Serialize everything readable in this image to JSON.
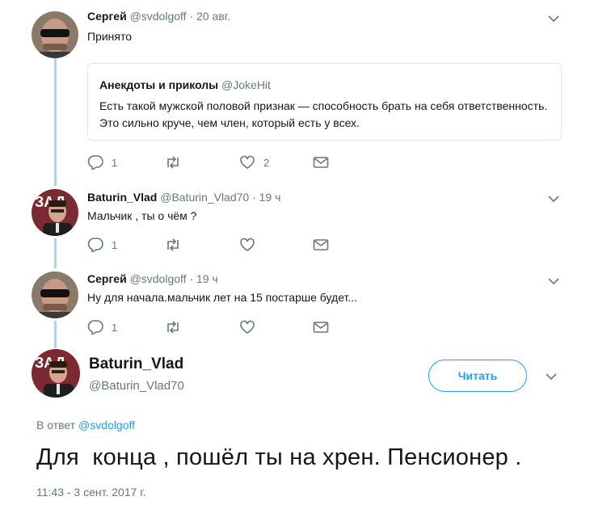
{
  "tweets": [
    {
      "name": "Сергей",
      "handle": "@svdolgoff",
      "time": "· 20 авг.",
      "text": "Принято",
      "avatar": "sergey-avatar",
      "quote": {
        "name": "Анекдоты и приколы",
        "handle": "@JokeHit",
        "text": "Есть такой мужской половой признак — способность брать на себя ответственность. Это сильно круче, чем член, который есть у всех."
      },
      "actions": {
        "replies": "1",
        "retweets": "",
        "likes": "2"
      }
    },
    {
      "name": "Baturin_Vlad",
      "handle": "@Baturin_Vlad70",
      "time": "· 19 ч",
      "text": "Мальчик , ты о чём ?",
      "avatar": "vlad-avatar",
      "actions": {
        "replies": "1",
        "retweets": "",
        "likes": ""
      }
    },
    {
      "name": "Сергей",
      "handle": "@svdolgoff",
      "time": "· 19 ч",
      "text": "Ну для начала.мальчик лет на 15 постарше будет...",
      "avatar": "sergey-avatar",
      "actions": {
        "replies": "1",
        "retweets": "",
        "likes": ""
      }
    }
  ],
  "main_tweet": {
    "name": "Baturin_Vlad",
    "handle": "@Baturin_Vlad70",
    "follow_label": "Читать",
    "reply_prefix": "В ответ",
    "reply_to": "@svdolgoff",
    "text": "Для  конца , пошёл ты на хрен. Пенсионер .",
    "timestamp": "11:43 - 3 сент. 2017 г."
  },
  "colors": {
    "accent": "#1da1f2",
    "thread_line": "#a0d8f5",
    "secondary_text": "#657786"
  }
}
